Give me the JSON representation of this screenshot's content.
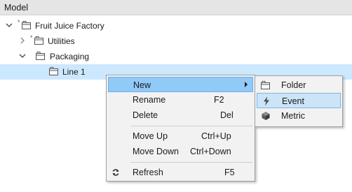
{
  "panel": {
    "title": "Model"
  },
  "tree": [
    {
      "label": "Fruit Juice Factory",
      "expanded": true,
      "modified_marker": "*"
    },
    {
      "label": "Utilities",
      "expanded": false,
      "modified_marker": "*"
    },
    {
      "label": "Packaging",
      "expanded": true
    },
    {
      "label": "Line 1",
      "selected": true
    }
  ],
  "context_menu": {
    "items": [
      {
        "label": "New",
        "shortcut": "",
        "has_submenu": true,
        "highlighted": true,
        "icon": ""
      },
      {
        "label": "Rename",
        "shortcut": "F2"
      },
      {
        "label": "Delete",
        "shortcut": "Del"
      },
      {
        "label": "Move Up",
        "shortcut": "Ctrl+Up"
      },
      {
        "label": "Move Down",
        "shortcut": "Ctrl+Down"
      },
      {
        "label": "Refresh",
        "shortcut": "F5",
        "icon": "refresh-icon"
      }
    ]
  },
  "submenu": {
    "items": [
      {
        "label": "Folder",
        "icon": "folder-icon"
      },
      {
        "label": "Event",
        "icon": "lightning-icon",
        "highlighted": true
      },
      {
        "label": "Metric",
        "icon": "cube-icon"
      }
    ]
  },
  "colors": {
    "selection": "#cce8ff",
    "menu_highlight": "#91c9f7",
    "submenu_highlight": "#cce4f7",
    "header_bg": "#e5e5e5"
  }
}
